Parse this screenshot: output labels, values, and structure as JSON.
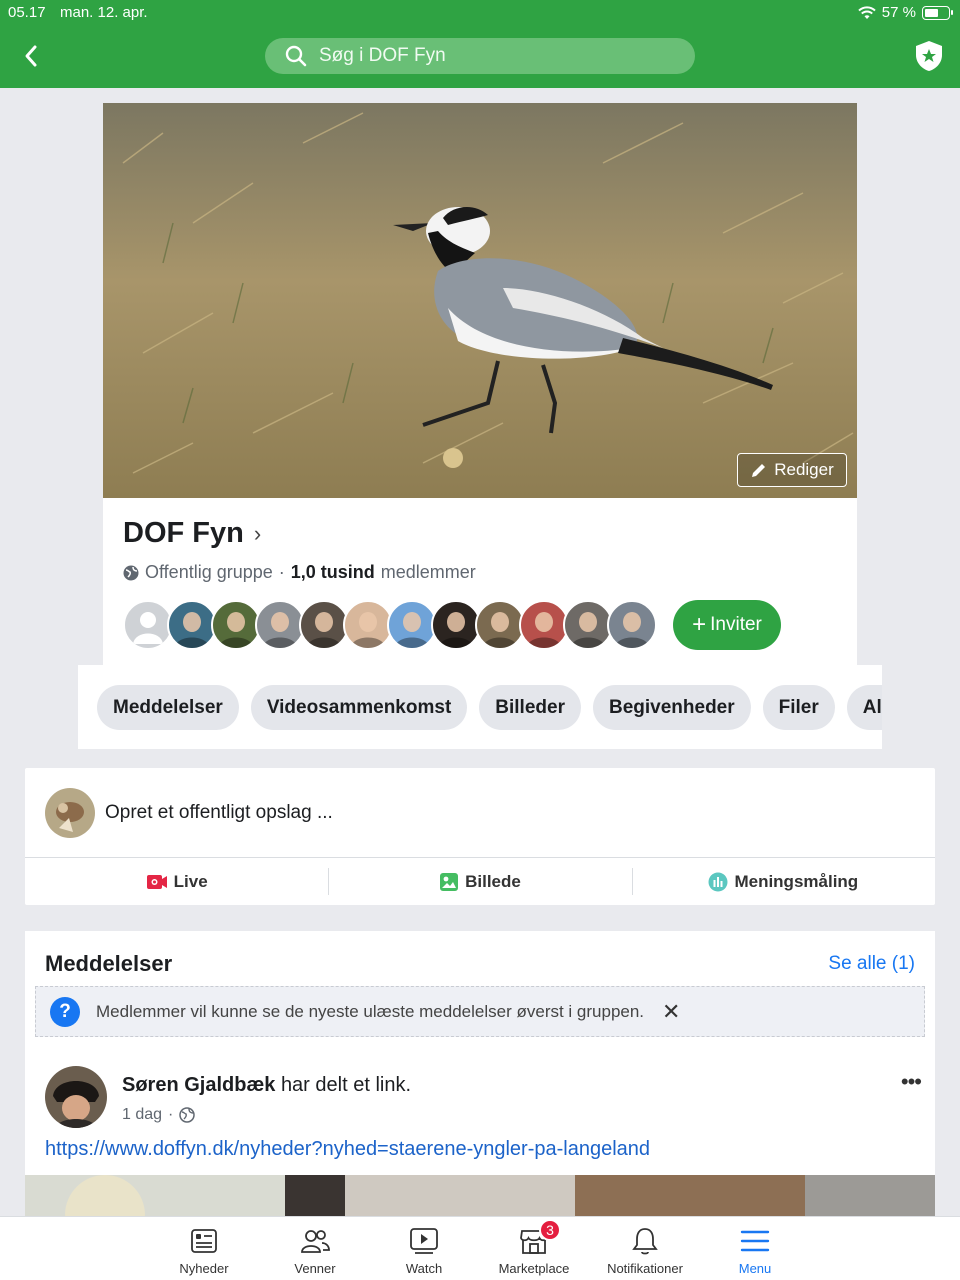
{
  "status_bar": {
    "time": "05.17",
    "date": "man. 12. apr.",
    "battery": "57 %",
    "battery_level": 0.57
  },
  "header": {
    "search_placeholder": "Søg i DOF Fyn"
  },
  "cover": {
    "edit_label": "Rediger"
  },
  "group": {
    "name": "DOF Fyn",
    "privacy": "Offentlig gruppe",
    "separator": "·",
    "member_count": "1,0 tusind",
    "member_suffix": "medlemmer",
    "invite_label": "Inviter",
    "avatar_colors": [
      "#cfd2d6",
      "#3c6d86",
      "#556b3a",
      "#8a8f95",
      "#5a5047",
      "#d8b79b",
      "#6fa3d8",
      "#2b2420",
      "#7b6a50",
      "#b7504b",
      "#6e6a66",
      "#7a8490"
    ]
  },
  "tabs": [
    "Meddelelser",
    "Videosammenkomst",
    "Billeder",
    "Begivenheder",
    "Filer",
    "Album"
  ],
  "composer": {
    "prompt": "Opret et offentligt opslag ...",
    "actions": {
      "live": "Live",
      "photo": "Billede",
      "poll": "Meningsmåling"
    }
  },
  "announcements": {
    "title": "Meddelelser",
    "see_all": "Se alle (1)",
    "notice": "Medlemmer vil kunne se de nyeste ulæste meddelelser øverst i gruppen.",
    "post": {
      "author": "Søren Gjaldbæk",
      "action": "har delt et link.",
      "time": "1 dag",
      "link": "https://www.doffyn.dk/nyheder?nyhed=staerene-yngler-pa-langeland"
    }
  },
  "tabbar": {
    "items": [
      "Nyheder",
      "Venner",
      "Watch",
      "Marketplace",
      "Notifikationer",
      "Menu"
    ],
    "marketplace_badge": "3",
    "active": "Menu",
    "accent": "#1877f2"
  },
  "colors": {
    "brand_green": "#2fa343",
    "link_blue": "#1c63c9"
  }
}
